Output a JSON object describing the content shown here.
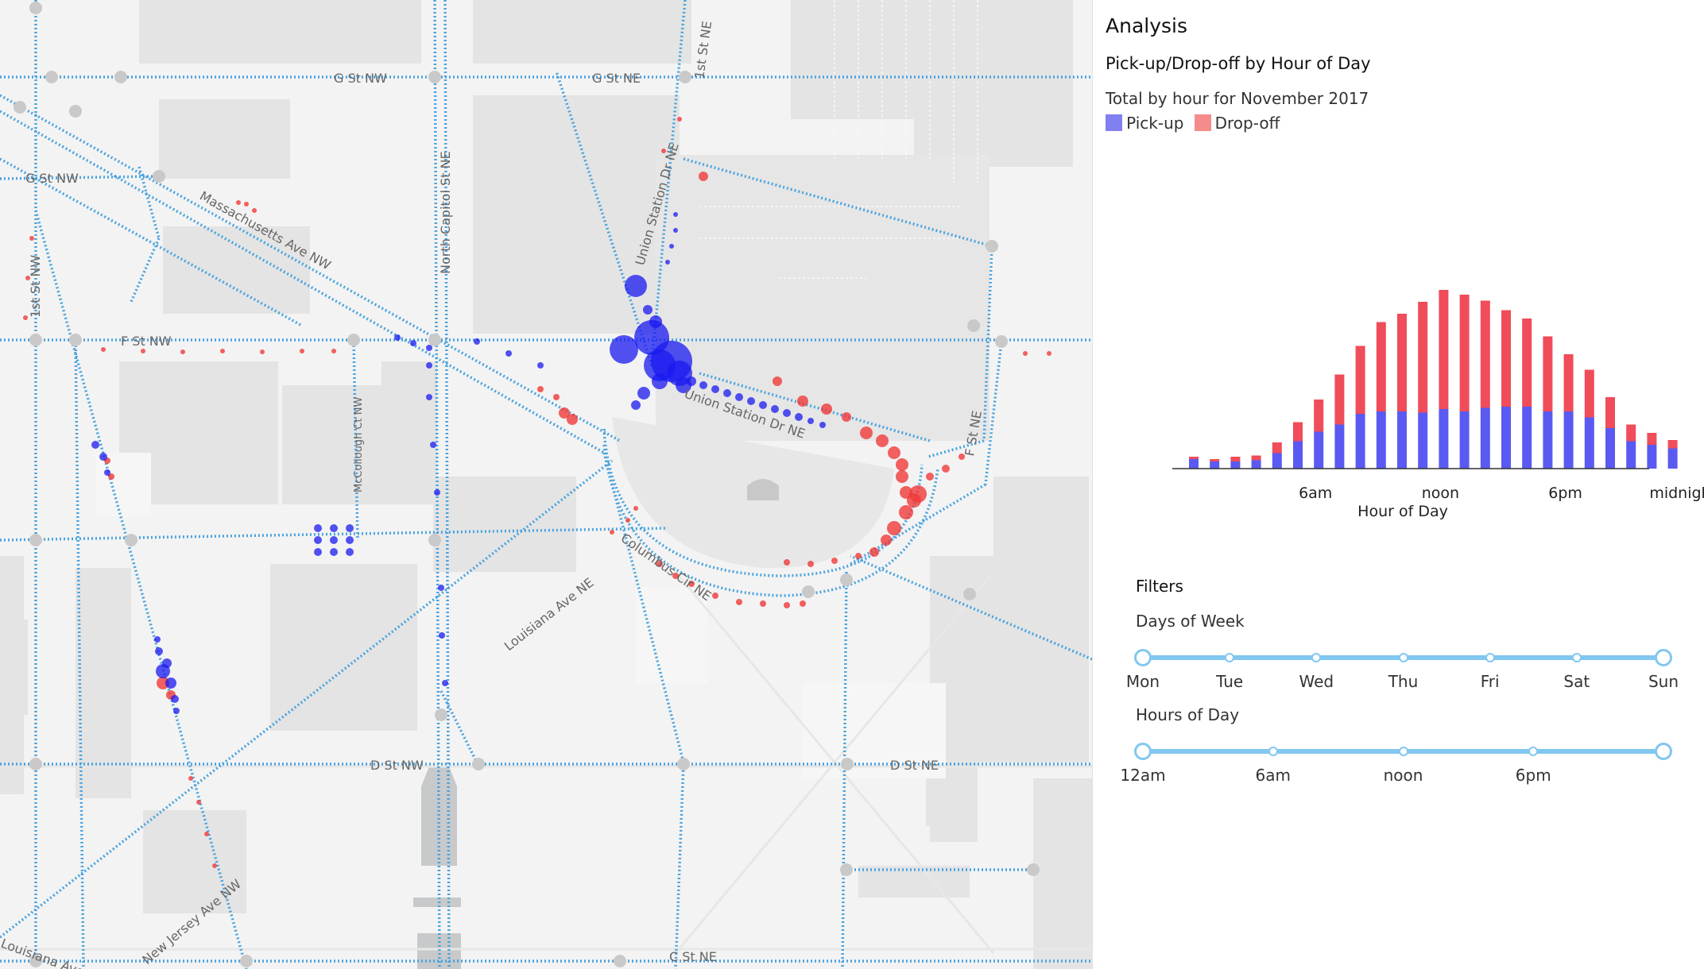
{
  "map": {
    "streets": [
      "G St NW",
      "G St NE",
      "G St NW",
      "Massachusetts Ave NW",
      "North Capitol St NE",
      "1st St NW",
      "F St NW",
      "Union Station Dr NE",
      "Union Station Dr NE",
      "1st St NE",
      "McCollough Ct NW",
      "F St NE",
      "Columbus Cir NE",
      "Louisiana Ave NE",
      "D St NW",
      "D St NE",
      "Louisiana Ave NW",
      "New Jersey Ave NW",
      "C St NE"
    ],
    "colors": {
      "route": "#4aa3df",
      "pickup": "#2f2ff5",
      "dropoff": "#f24b4b",
      "block": "#e3e3e3"
    }
  },
  "panel": {
    "title": "Analysis",
    "chart_title": "Pick-up/Drop-off by Hour of Day",
    "subtitle": "Total by hour for November 2017",
    "legend": [
      {
        "label": "Pick-up",
        "color": "#8080f0"
      },
      {
        "label": "Drop-off",
        "color": "#f58c8c"
      }
    ]
  },
  "chart_data": {
    "type": "bar",
    "stacked": true,
    "xlabel": "Hour of Day",
    "ylabel": "",
    "ylim": [
      0,
      100
    ],
    "categories": [
      0,
      1,
      2,
      3,
      4,
      5,
      6,
      7,
      8,
      9,
      10,
      11,
      12,
      13,
      14,
      15,
      16,
      17,
      18,
      19,
      20,
      21,
      22,
      23
    ],
    "tick_labels": [
      "6am",
      "noon",
      "6pm",
      "midnight"
    ],
    "series": [
      {
        "name": "Pick-up",
        "color": "#5a5af2",
        "values": [
          8,
          6,
          6,
          7,
          13,
          23,
          31,
          37,
          46,
          48,
          48,
          47,
          50,
          48,
          51,
          52,
          52,
          48,
          48,
          43,
          34,
          23,
          20,
          17
        ]
      },
      {
        "name": "Drop-off",
        "color": "#f04c5a",
        "values": [
          2,
          2,
          4,
          4,
          9,
          16,
          27,
          42,
          57,
          75,
          82,
          93,
          100,
          98,
          90,
          81,
          74,
          63,
          48,
          40,
          26,
          14,
          10,
          7
        ]
      }
    ]
  },
  "filters": {
    "title": "Filters",
    "days": {
      "label": "Days of Week",
      "ticks": [
        "Mon",
        "Tue",
        "Wed",
        "Thu",
        "Fri",
        "Sat",
        "Sun"
      ]
    },
    "hours": {
      "label": "Hours of Day",
      "ticks": [
        "12am",
        "6am",
        "noon",
        "6pm"
      ]
    }
  }
}
